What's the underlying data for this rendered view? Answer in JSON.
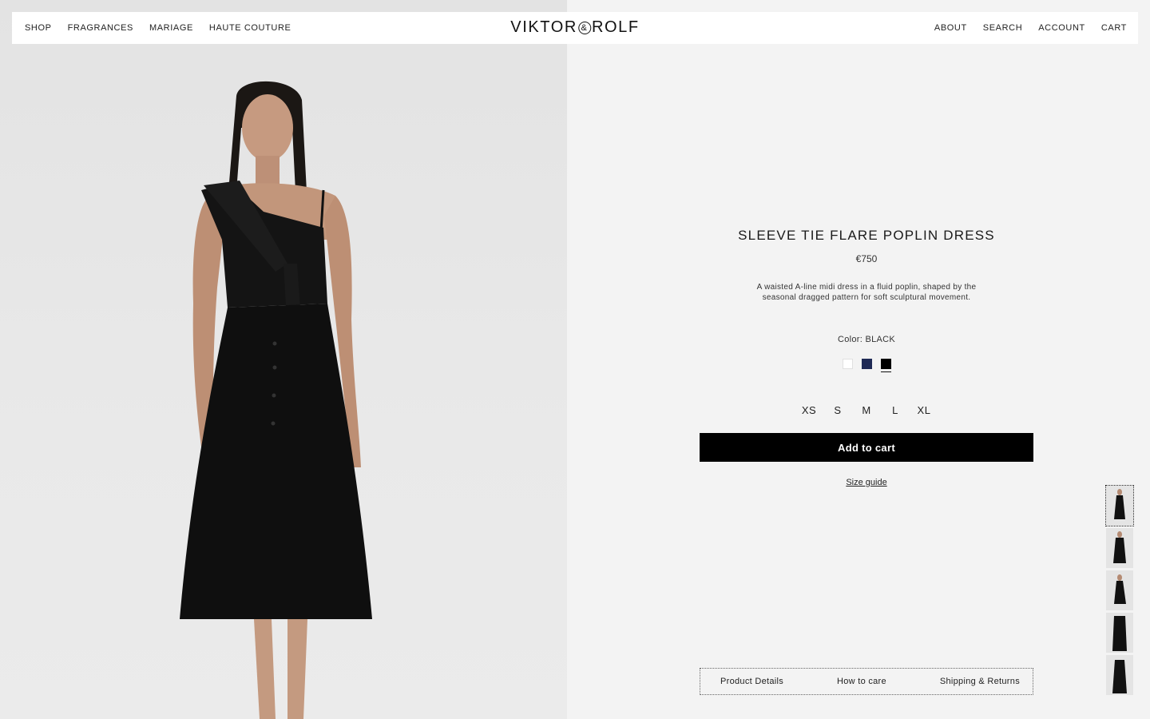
{
  "header": {
    "nav": [
      "SHOP",
      "FRAGRANCES",
      "MARIAGE",
      "HAUTE COUTURE"
    ],
    "logo": {
      "left": "VIKTOR",
      "amp": "&",
      "right": "ROLF"
    },
    "utility": [
      "ABOUT",
      "SEARCH",
      "ACCOUNT",
      "CART"
    ]
  },
  "product": {
    "title": "SLEEVE TIE FLARE POPLIN DRESS",
    "price": "€750",
    "description": "A waisted A-line midi dress in a fluid poplin, shaped by the seasonal dragged pattern for soft sculptural movement.",
    "color_label": "Color: BLACK",
    "colors": [
      {
        "name": "white",
        "hex": "#ffffff",
        "selected": false
      },
      {
        "name": "navy",
        "hex": "#1f2a55",
        "selected": false
      },
      {
        "name": "black",
        "hex": "#000000",
        "selected": true
      }
    ],
    "sizes": [
      "XS",
      "S",
      "M",
      "L",
      "XL"
    ],
    "add_to_cart": "Add to cart",
    "size_guide": "Size guide"
  },
  "tabs": [
    "Product Details",
    "How to care",
    "Shipping & Returns"
  ],
  "thumbnails": {
    "count": 5,
    "active_index": 0
  },
  "colors": {
    "background_panel": "#f3f3f3",
    "background_image": "#e6e6e6",
    "button": "#000000",
    "button_text": "#ffffff"
  }
}
